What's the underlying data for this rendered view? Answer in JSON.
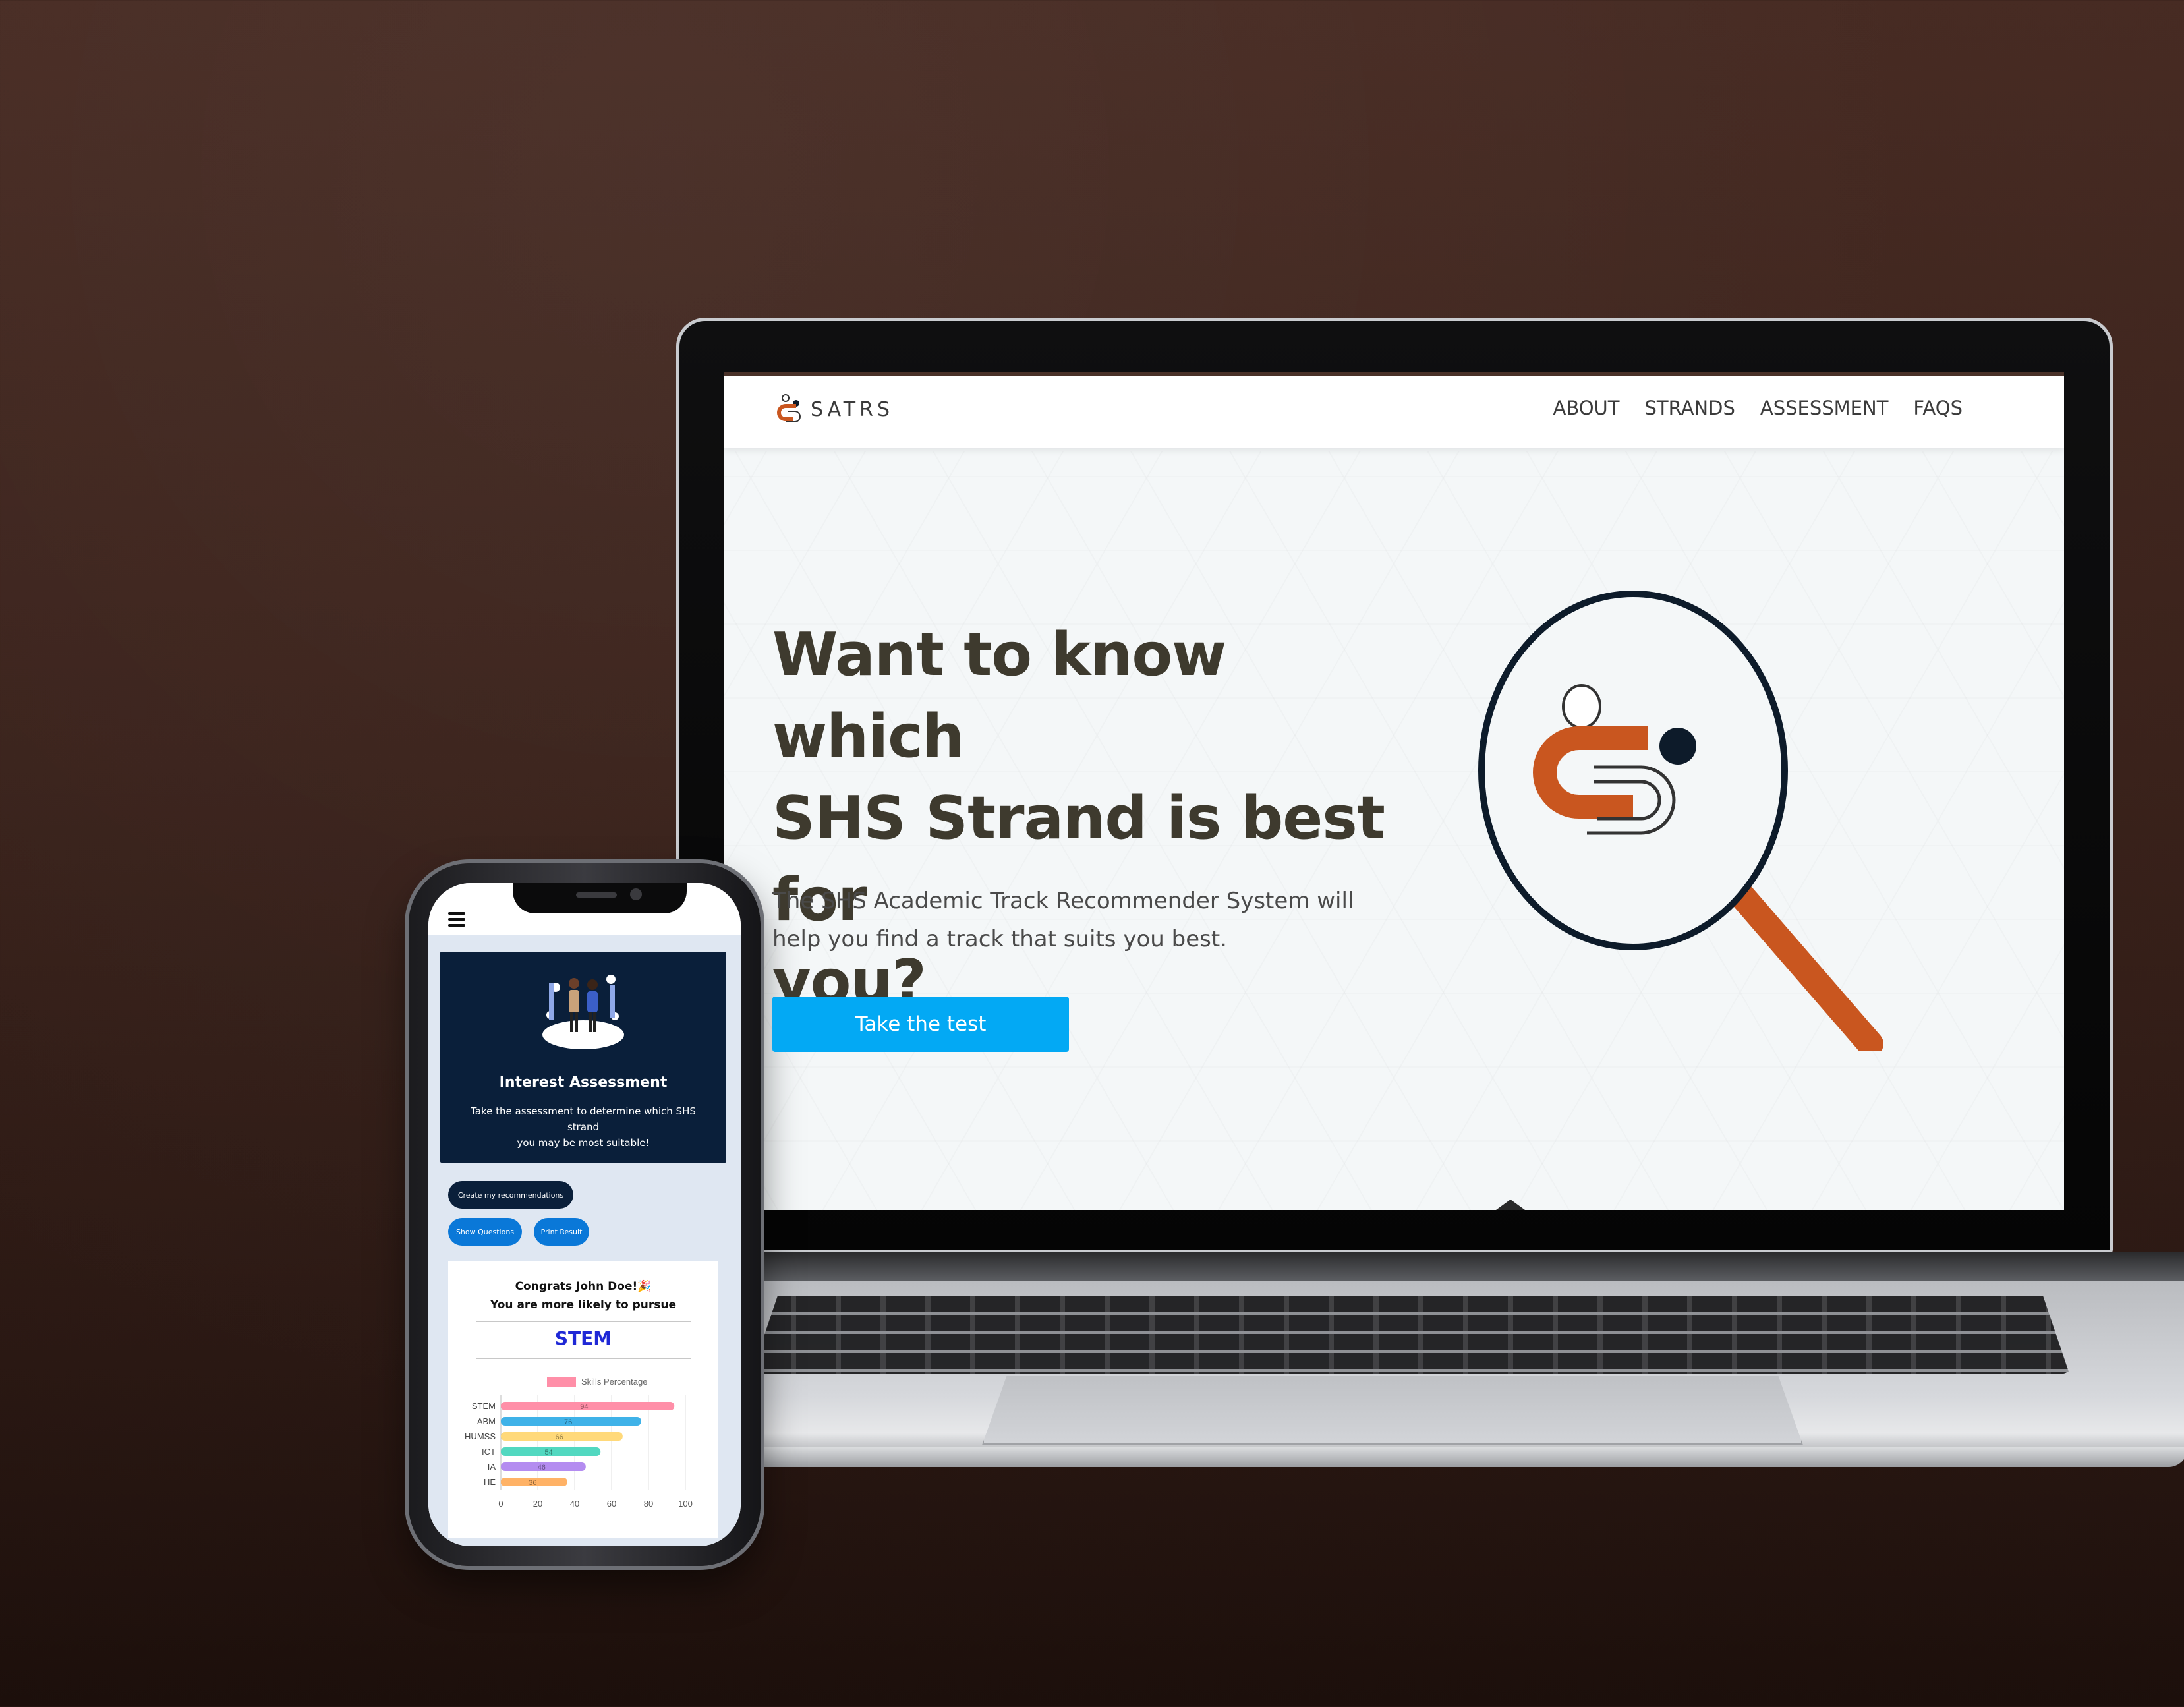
{
  "laptop_site": {
    "brand": "SATRS",
    "nav": [
      "ABOUT",
      "STRANDS",
      "ASSESSMENT",
      "FAQS"
    ],
    "hero_title_lines": [
      "Want to know which",
      "SHS Strand is best for",
      "you?"
    ],
    "hero_subtitle_lines": [
      "The SHS Academic Track Recommender System will",
      "help you find a track that suits you best."
    ],
    "cta_label": "Take the test",
    "colors": {
      "accent": "#c9561f",
      "dark": "#0d1b2a",
      "cta": "#03a9f4"
    }
  },
  "phone_app": {
    "card_title": "Interest Assessment",
    "card_desc_lines": [
      "Take the assessment to determine which SHS strand",
      "you may be most suitable!"
    ],
    "buttons": {
      "create": "Create my recommendations",
      "show_questions": "Show Questions",
      "print_result": "Print Result"
    },
    "congrats_line1": "Congrats John Doe!🎉",
    "congrats_line2": "You are more likely to pursue",
    "result_strand": "STEM"
  },
  "chart_data": {
    "type": "bar",
    "orientation": "horizontal",
    "categories": [
      "STEM",
      "ABM",
      "HUMSS",
      "ICT",
      "IA",
      "HE"
    ],
    "series": [
      {
        "name": "Skills Percentage",
        "values": [
          94,
          76,
          66,
          54,
          46,
          36
        ]
      }
    ],
    "xlim": [
      0,
      100
    ],
    "xticks": [
      0,
      20,
      40,
      60,
      80,
      100
    ],
    "bar_colors": [
      "#ff8fa8",
      "#3fb2e8",
      "#ffd97a",
      "#52d8c0",
      "#b48cf0",
      "#ffb266"
    ],
    "legend_color": "#ff8fa8",
    "legend_placement": "top",
    "grid": true
  }
}
